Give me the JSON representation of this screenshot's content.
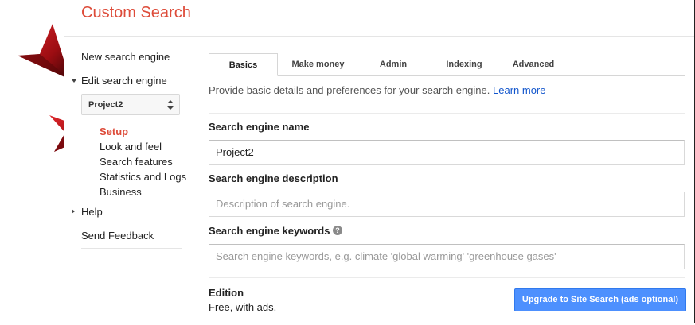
{
  "header": {
    "title": "Custom Search"
  },
  "sidebar": {
    "new_engine": "New search engine",
    "edit_engine": "Edit search engine",
    "selected_engine": "Project2",
    "sub_items": [
      {
        "label": "Setup",
        "active": true
      },
      {
        "label": "Look and feel"
      },
      {
        "label": "Search features"
      },
      {
        "label": "Statistics and Logs"
      },
      {
        "label": "Business"
      }
    ],
    "help": "Help",
    "feedback": "Send Feedback"
  },
  "tabs": [
    {
      "label": "Basics",
      "active": true
    },
    {
      "label": "Make money"
    },
    {
      "label": "Admin"
    },
    {
      "label": "Indexing"
    },
    {
      "label": "Advanced"
    }
  ],
  "intro": {
    "text": "Provide basic details and preferences for your search engine.",
    "link": "Learn more"
  },
  "form": {
    "name_label": "Search engine name",
    "name_value": "Project2",
    "description_label": "Search engine description",
    "description_placeholder": "Description of search engine.",
    "keywords_label": "Search engine keywords",
    "keywords_placeholder": "Search engine keywords, e.g. climate 'global warming' 'greenhouse gases'",
    "help_glyph": "?"
  },
  "edition": {
    "title": "Edition",
    "value": "Free, with ads.",
    "upgrade_button": "Upgrade to Site Search (ads optional)"
  },
  "colors": {
    "brand_red": "#dd4b39",
    "link_blue": "#1155cc",
    "button_blue": "#4d90fe",
    "annotation_arrow": "#c0161b"
  },
  "icons": [
    "annotation-arrow-icon",
    "chevron-down-icon",
    "chevron-right-icon",
    "select-arrows-icon",
    "help-icon"
  ]
}
